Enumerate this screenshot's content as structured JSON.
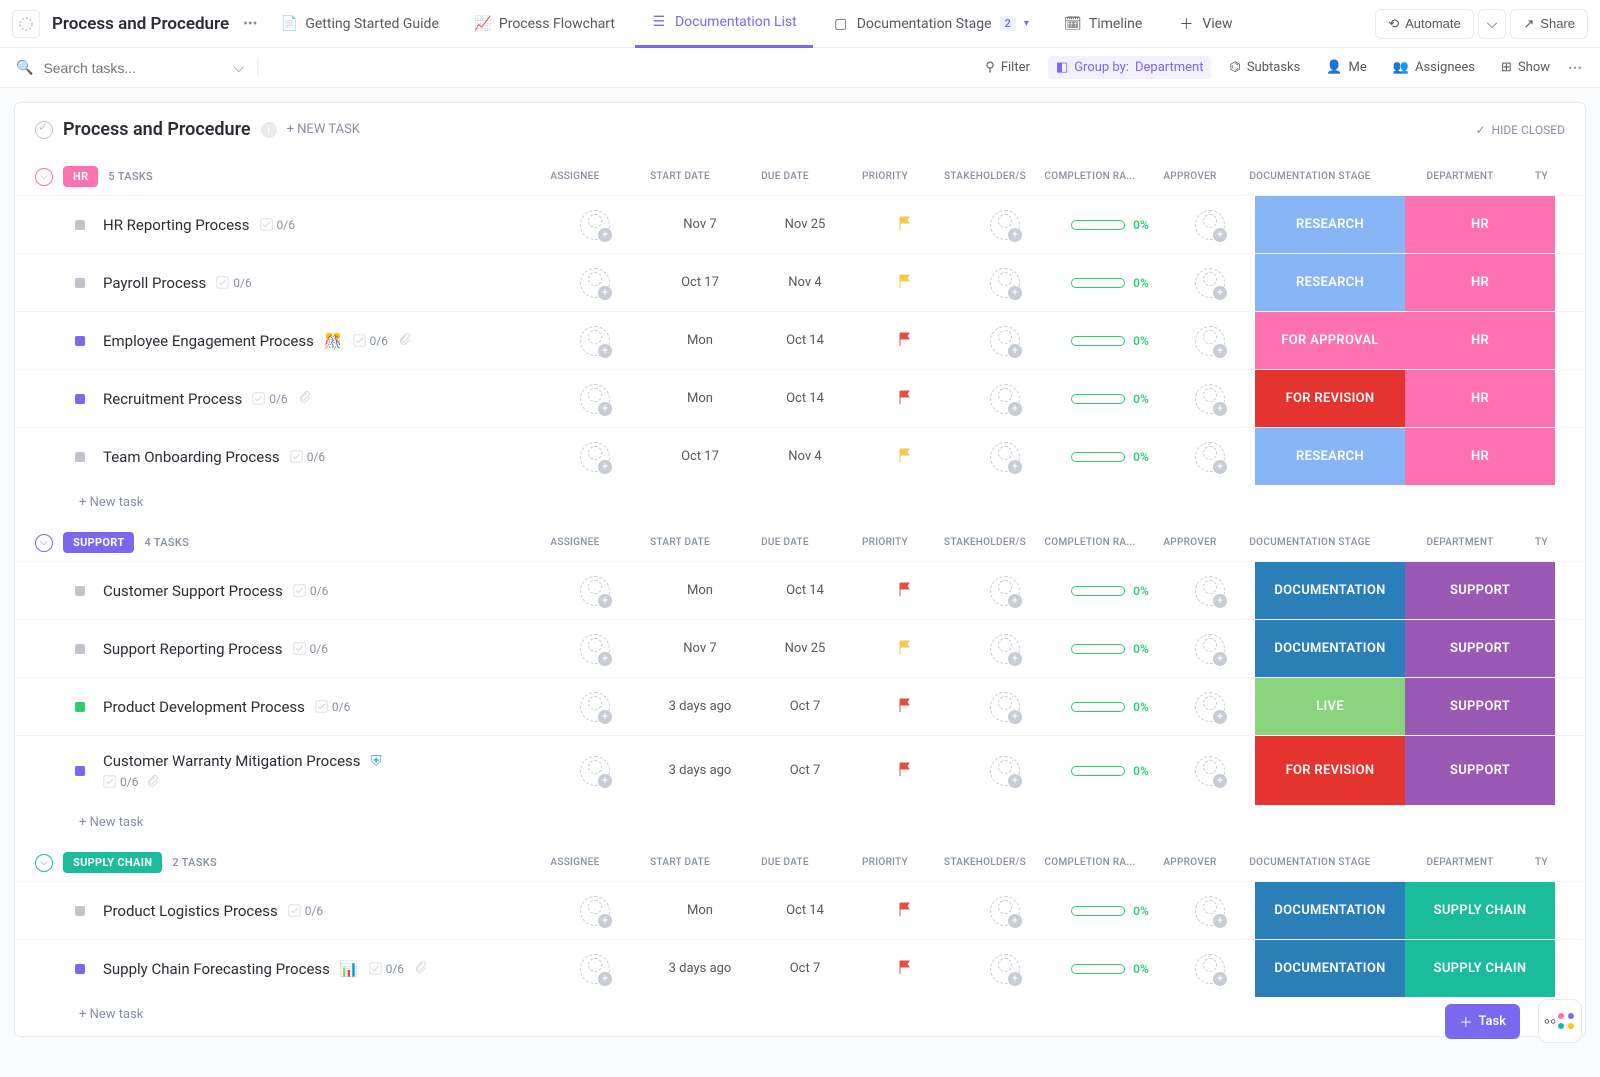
{
  "workspace": {
    "title": "Process and Procedure"
  },
  "tabs": [
    {
      "icon": "doc",
      "label": "Getting Started Guide"
    },
    {
      "icon": "flow",
      "label": "Process Flowchart"
    },
    {
      "icon": "list",
      "label": "Documentation List",
      "active": true
    },
    {
      "icon": "board",
      "label": "Documentation Stage",
      "badge": "2",
      "dropdown": true
    },
    {
      "icon": "timeline",
      "label": "Timeline"
    },
    {
      "icon": "plus",
      "label": "View"
    }
  ],
  "topActions": {
    "automate": "Automate",
    "share": "Share"
  },
  "toolbar": {
    "searchPlaceholder": "Search tasks...",
    "filter": "Filter",
    "groupByLabel": "Group by:",
    "groupByValue": "Department",
    "subtasks": "Subtasks",
    "me": "Me",
    "assignees": "Assignees",
    "show": "Show"
  },
  "panel": {
    "title": "Process and Procedure",
    "newTask": "+ NEW TASK",
    "hideClosed": "HIDE CLOSED"
  },
  "columns": {
    "assignee": "ASSIGNEE",
    "start": "START DATE",
    "due": "DUE DATE",
    "priority": "PRIORITY",
    "stakeholders": "STAKEHOLDER/S",
    "completion": "COMPLETION RA...",
    "approver": "APPROVER",
    "stage": "DOCUMENTATION STAGE",
    "department": "DEPARTMENT",
    "ty": "TY"
  },
  "newTaskRow": "+ New task",
  "stageLabels": {
    "research": "RESEARCH",
    "approval": "FOR APPROVAL",
    "revision": "FOR REVISION",
    "documentation": "DOCUMENTATION",
    "live": "LIVE"
  },
  "deptLabels": {
    "hr": "HR",
    "support": "SUPPORT",
    "supply": "SUPPLY CHAIN"
  },
  "groups": [
    {
      "key": "hr",
      "name": "HR",
      "count": "5 TASKS",
      "tasks": [
        {
          "status": "grey",
          "name": "HR Reporting Process",
          "sub": "0/6",
          "start": "Nov 7",
          "due": "Nov 25",
          "flag": "yellow",
          "pct": "0%",
          "stage": "research",
          "dept": "hr"
        },
        {
          "status": "grey",
          "name": "Payroll Process",
          "sub": "0/6",
          "start": "Oct 17",
          "due": "Nov 4",
          "flag": "yellow",
          "pct": "0%",
          "stage": "research",
          "dept": "hr"
        },
        {
          "status": "purple",
          "name": "Employee Engagement Process",
          "emoji": "🎊",
          "sub": "0/6",
          "clip": true,
          "start": "Mon",
          "due": "Oct 14",
          "flag": "red",
          "pct": "0%",
          "stage": "approval",
          "dept": "hr"
        },
        {
          "status": "purple",
          "name": "Recruitment Process",
          "sub": "0/6",
          "clip": true,
          "start": "Mon",
          "due": "Oct 14",
          "flag": "red",
          "pct": "0%",
          "stage": "revision",
          "dept": "hr"
        },
        {
          "status": "grey",
          "name": "Team Onboarding Process",
          "sub": "0/6",
          "start": "Oct 17",
          "due": "Nov 4",
          "flag": "yellow",
          "pct": "0%",
          "stage": "research",
          "dept": "hr"
        }
      ]
    },
    {
      "key": "support",
      "name": "SUPPORT",
      "count": "4 TASKS",
      "tasks": [
        {
          "status": "grey",
          "name": "Customer Support Process",
          "sub": "0/6",
          "start": "Mon",
          "due": "Oct 14",
          "flag": "red",
          "pct": "0%",
          "stage": "documentation",
          "dept": "support"
        },
        {
          "status": "grey",
          "name": "Support Reporting Process",
          "sub": "0/6",
          "start": "Nov 7",
          "due": "Nov 25",
          "flag": "yellow",
          "pct": "0%",
          "stage": "documentation",
          "dept": "support"
        },
        {
          "status": "green",
          "name": "Product Development Process",
          "sub": "0/6",
          "start": "3 days ago",
          "due": "Oct 7",
          "flag": "red",
          "pct": "0%",
          "stage": "live",
          "dept": "support"
        },
        {
          "status": "purple",
          "name": "Customer Warranty Mitigation Process",
          "shield": true,
          "sub": "0/6",
          "clip": true,
          "twoLine": true,
          "start": "3 days ago",
          "due": "Oct 7",
          "flag": "red",
          "pct": "0%",
          "stage": "revision",
          "dept": "support"
        }
      ]
    },
    {
      "key": "supply",
      "name": "SUPPLY CHAIN",
      "count": "2 TASKS",
      "tasks": [
        {
          "status": "grey",
          "name": "Product Logistics Process",
          "sub": "0/6",
          "start": "Mon",
          "due": "Oct 14",
          "flag": "red",
          "pct": "0%",
          "stage": "documentation",
          "dept": "supply"
        },
        {
          "status": "purple",
          "name": "Supply Chain Forecasting Process",
          "emoji": "📊",
          "sub": "0/6",
          "clip": true,
          "start": "3 days ago",
          "due": "Oct 7",
          "flag": "red",
          "pct": "0%",
          "stage": "documentation",
          "dept": "supply"
        }
      ]
    }
  ],
  "fab": {
    "task": "Task"
  }
}
